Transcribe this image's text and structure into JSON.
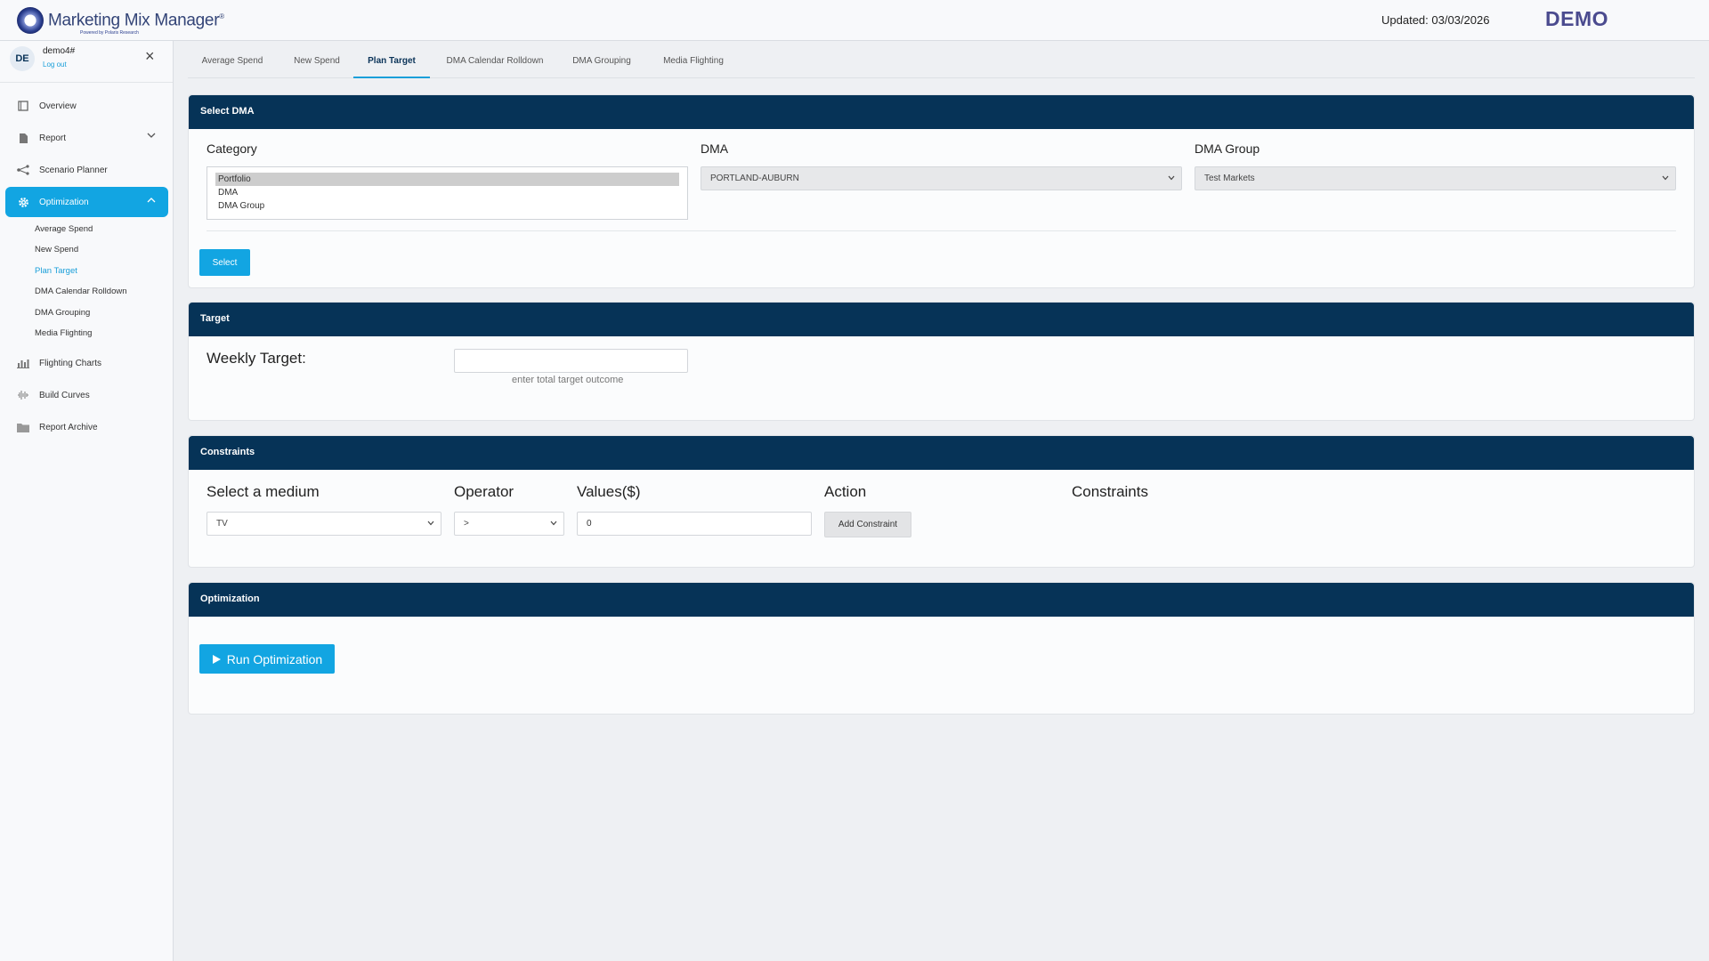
{
  "header": {
    "app_title": "Marketing Mix Manager",
    "trademark": "®",
    "powered_by": "Powered by Polaris Research",
    "updated": "Updated: 03/03/2026",
    "badge": "DEMO"
  },
  "user": {
    "initials": "DE",
    "name": "demo4#",
    "logout": "Log out"
  },
  "sidebar": {
    "items": [
      {
        "label": "Overview",
        "icon": "square-icon"
      },
      {
        "label": "Report",
        "icon": "document-icon"
      },
      {
        "label": "Scenario Planner",
        "icon": "branch-icon"
      },
      {
        "label": "Optimization",
        "icon": "gear-icon"
      },
      {
        "label": "Flighting Charts",
        "icon": "bar-chart-icon"
      },
      {
        "label": "Build Curves",
        "icon": "waveform-icon"
      },
      {
        "label": "Report Archive",
        "icon": "folder-icon"
      }
    ],
    "sub_items": [
      "Average Spend",
      "New Spend",
      "Plan Target",
      "DMA Calendar Rolldown",
      "DMA Grouping",
      "Media Flighting"
    ],
    "current_sub": "Plan Target"
  },
  "tabs": [
    "Average Spend",
    "New Spend",
    "Plan Target",
    "DMA Calendar Rolldown",
    "DMA Grouping",
    "Media Flighting"
  ],
  "active_tab": "Plan Target",
  "select_dma": {
    "title": "Select DMA",
    "category_label": "Category",
    "category_options": [
      "Portfolio",
      "DMA",
      "DMA Group"
    ],
    "category_selected": "Portfolio",
    "dma_label": "DMA",
    "dma_value": "PORTLAND-AUBURN",
    "dma_group_label": "DMA Group",
    "dma_group_value": "Test Markets",
    "select_button": "Select"
  },
  "target": {
    "title": "Target",
    "weekly_label": "Weekly Target:",
    "weekly_value": "",
    "hint": "enter total target outcome"
  },
  "constraints": {
    "title": "Constraints",
    "medium_label": "Select a medium",
    "medium_value": "TV",
    "operator_label": "Operator",
    "operator_value": ">",
    "values_label": "Values($)",
    "values_value": "0",
    "action_label": "Action",
    "add_button": "Add Constraint",
    "constraints_label": "Constraints"
  },
  "optimization": {
    "title": "Optimization",
    "run_button": "Run Optimization"
  },
  "colors": {
    "accent": "#12a5e2",
    "header_navy": "#063357",
    "demo_purple": "#4b4b8f"
  }
}
